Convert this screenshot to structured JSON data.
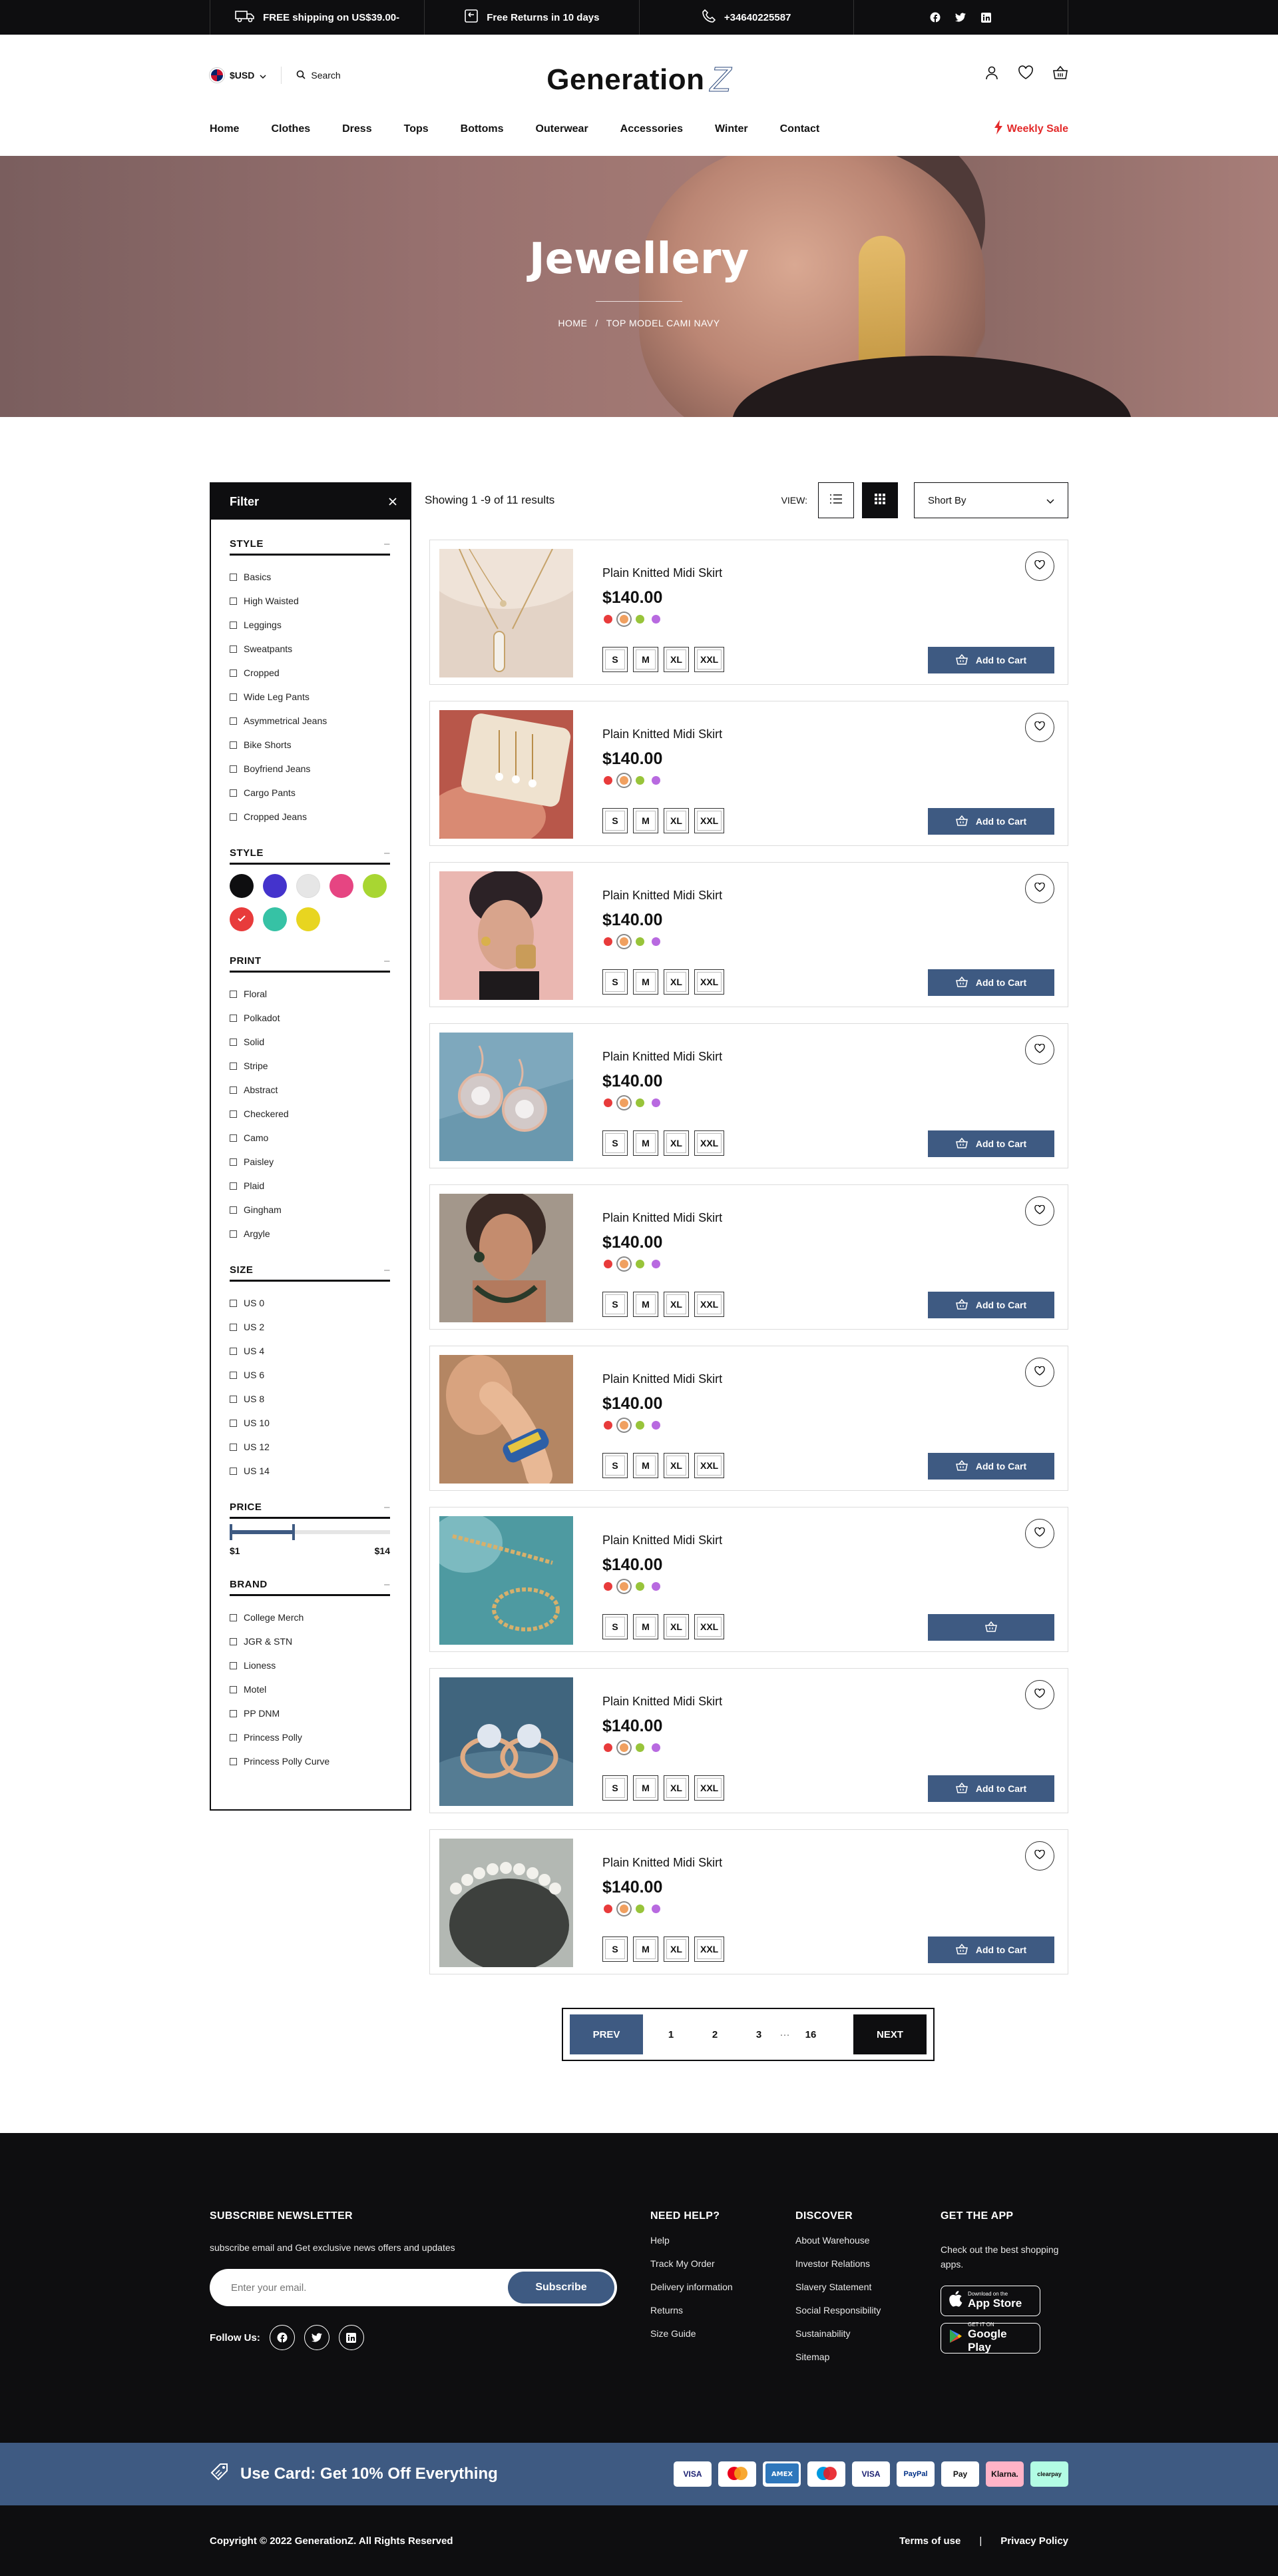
{
  "topbar": {
    "shipping": "FREE shipping on US$39.00-",
    "returns": "Free Returns in 10 days",
    "phone": "+34640225587",
    "social_icons": [
      "facebook-icon",
      "twitter-icon",
      "linkedin-icon"
    ]
  },
  "header": {
    "currency": "$USD",
    "search_label": "Search",
    "logo_text": "Generation",
    "logo_mark": "Z",
    "icons": [
      "user-icon",
      "heart-icon",
      "basket-icon"
    ]
  },
  "nav": {
    "items": [
      "Home",
      "Clothes",
      "Dress",
      "Tops",
      "Bottoms",
      "Outerwear",
      "Accessories",
      "Winter",
      "Contact"
    ],
    "sale": "Weekly Sale",
    "sale_color": "#e32a2a"
  },
  "hero": {
    "title": "Jewellery",
    "crumb_home": "HOME",
    "crumb_sep": "/",
    "crumb_current": "TOP MODEL CAMI NAVY"
  },
  "filter": {
    "title": "Filter",
    "collapse": "–",
    "style_title": "STYLE",
    "style_items": [
      "Basics",
      "High Waisted",
      "Leggings",
      "Sweatpants",
      "Cropped",
      "Wide Leg Pants",
      "Asymmetrical Jeans",
      "Bike Shorts",
      "Boyfriend Jeans",
      "Cargo Pants",
      "Cropped Jeans"
    ],
    "color_title": "STYLE",
    "colors": [
      "#0e0e10",
      "#4433cc",
      "#e6e6e6",
      "#e64582",
      "#a8d632",
      "#e83b3b",
      "#36c2a5",
      "#e8d520"
    ],
    "selected_color_index": 5,
    "print_title": "PRINT",
    "print_items": [
      "Floral",
      "Polkadot",
      "Solid",
      "Stripe",
      "Abstract",
      "Checkered",
      "Camo",
      "Paisley",
      "Plaid",
      "Gingham",
      "Argyle"
    ],
    "size_title": "SIZE",
    "size_items": [
      "US 0",
      "US 2",
      "US 4",
      "US 6",
      "US 8",
      "US 10",
      "US 12",
      "US 14"
    ],
    "price_title": "PRICE",
    "price_min": "$1",
    "price_max": "$14",
    "price_fill_fraction": 0.4,
    "brand_title": "BRAND",
    "brand_items": [
      "College Merch",
      "JGR & STN",
      "Lioness",
      "Motel",
      "PP DNM",
      "Princess Polly",
      "Princess Polly Curve"
    ]
  },
  "toolbar": {
    "results": "Showing 1 -9 of 11 results",
    "view_label": "VIEW:",
    "sort_label": "Short By"
  },
  "products": [
    {
      "name": "Plain Knitted Midi Skirt",
      "price": "$140.00",
      "cart": "Add to Cart",
      "image": "pendant-necklace"
    },
    {
      "name": "Plain Knitted Midi Skirt",
      "price": "$140.00",
      "cart": "Add to Cart",
      "image": "drop-earrings-box"
    },
    {
      "name": "Plain Knitted Midi Skirt",
      "price": "$140.00",
      "cart": "Add to Cart",
      "image": "model-turban"
    },
    {
      "name": "Plain Knitted Midi Skirt",
      "price": "$140.00",
      "cart": "Add to Cart",
      "image": "crystal-earrings"
    },
    {
      "name": "Plain Knitted Midi Skirt",
      "price": "$140.00",
      "cart": "Add to Cart",
      "image": "model-necklace"
    },
    {
      "name": "Plain Knitted Midi Skirt",
      "price": "$140.00",
      "cart": "Add to Cart",
      "image": "hand-bangle"
    },
    {
      "name": "Plain Knitted Midi Skirt",
      "price": "$140.00",
      "cart": "",
      "image": "gold-chains"
    },
    {
      "name": "Plain Knitted Midi Skirt",
      "price": "$140.00",
      "cart": "Add to Cart",
      "image": "diamond-rings"
    },
    {
      "name": "Plain Knitted Midi Skirt",
      "price": "$140.00",
      "cart": "Add to Cart",
      "image": "pearl-bracelet"
    }
  ],
  "product_colors": [
    "#e83b3b",
    "#f0a060",
    "#98c43a",
    "#b86ae0"
  ],
  "sizes": [
    "S",
    "M",
    "XL",
    "XXL"
  ],
  "pager": {
    "prev": "PREV",
    "pages": [
      "1",
      "2",
      "3"
    ],
    "ellipsis": "···",
    "last": "16",
    "next": "NEXT"
  },
  "footer": {
    "newsletter_title": "SUBSCRIBE NEWSLETTER",
    "newsletter_text": "subscribe email and Get exclusive news offers and updates",
    "email_placeholder": "Enter your email.",
    "subscribe": "Subscribe",
    "follow": "Follow Us:",
    "help_title": "NEED HELP?",
    "help_links": [
      "Help",
      "Track My Order",
      "Delivery information",
      "Returns",
      "Size Guide"
    ],
    "discover_title": "DISCOVER",
    "discover_links": [
      "About Warehouse",
      "Investor Relations",
      "Slavery Statement",
      "Social Responsibility",
      "Sustainability",
      "Sitemap"
    ],
    "app_title": "GET THE APP",
    "app_text": "Check out the best shopping apps.",
    "appstore_small": "Download on the",
    "appstore": "App Store",
    "gplay_small": "GET IT ON",
    "gplay": "Google Play"
  },
  "promo": {
    "text": "Use Card:  Get 10% Off Everything",
    "payments": [
      "VISA",
      "MC",
      "AMEX",
      "Maestro",
      "VISA",
      "PayPal",
      "Pay",
      "Klarna.",
      "clearpay"
    ]
  },
  "bottom": {
    "copyright": "Copyright © 2022 GenerationZ. All Rights Reserved",
    "terms": "Terms of use",
    "sep": "|",
    "privacy": "Privacy Policy"
  }
}
